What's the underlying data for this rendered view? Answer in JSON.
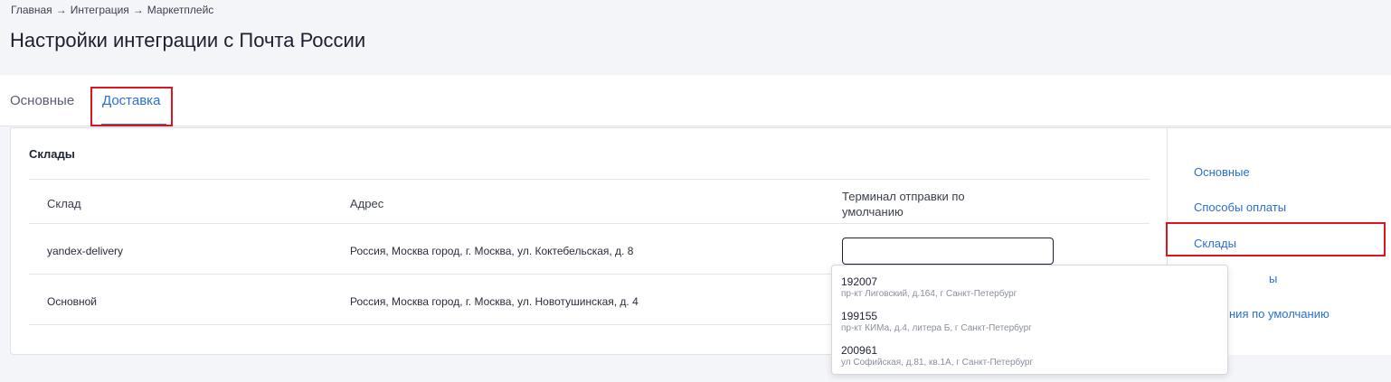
{
  "breadcrumb": {
    "items": [
      "Главная",
      "Интеграция",
      "Маркетплейс"
    ],
    "separator": "→"
  },
  "page_title": "Настройки интеграции с Почта России",
  "tabs": [
    {
      "label": "Основные",
      "active": false
    },
    {
      "label": "Доставка",
      "active": true
    }
  ],
  "warehouses": {
    "title": "Склады",
    "columns": [
      "Склад",
      "Адрес",
      "Терминал отправки по умолчанию"
    ],
    "rows": [
      {
        "name": "yandex-delivery",
        "address": "Россия, Москва город, г. Москва, ул. Коктебельская, д. 8",
        "terminal": ""
      },
      {
        "name": "Основной",
        "address": "Россия, Москва город, г. Москва, ул. Новотушинская, д. 4",
        "terminal": ""
      }
    ]
  },
  "side_nav": {
    "items": [
      "Основные",
      "Способы оплаты",
      "Склады",
      "Тарифы",
      "Значения по умолчанию"
    ],
    "visible_fragments": [
      "Основные",
      "Способы оплаты",
      "Склады",
      "ы",
      "ния по умолчанию"
    ]
  },
  "dropdown": {
    "options": [
      {
        "code": "192007",
        "address": "пр-кт Лиговский, д.164, г Санкт-Петербург"
      },
      {
        "code": "199155",
        "address": "пр-кт КИМа, д.4, литера Б, г Санкт-Петербург"
      },
      {
        "code": "200961",
        "address": "ул Софийская, д.81, кв.1А, г Санкт-Петербург"
      }
    ]
  },
  "colors": {
    "accent": "#2a6fd6",
    "highlight": "#e0141e",
    "background": "#f4f5f8"
  }
}
